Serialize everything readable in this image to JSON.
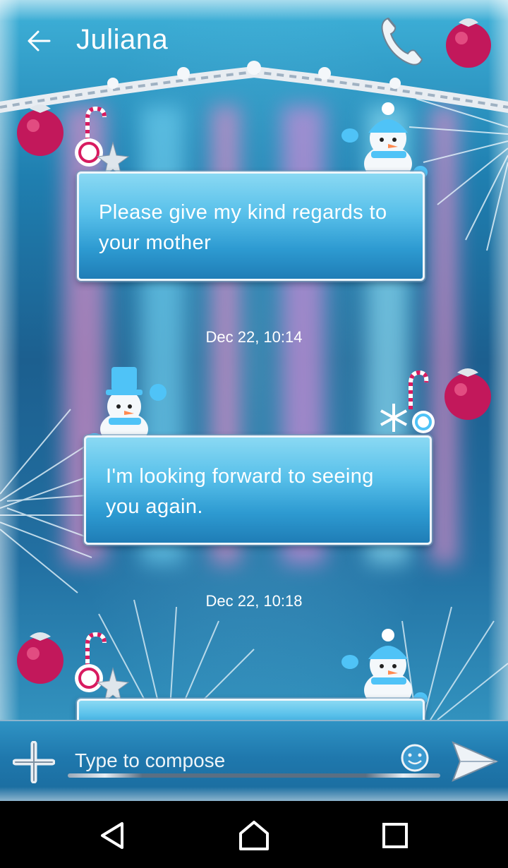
{
  "header": {
    "back_icon": "arrow-left-icon",
    "title": "Juliana",
    "call_icon": "phone-icon"
  },
  "messages": [
    {
      "text": "Please give my kind regards to your mother",
      "timestamp": "Dec 22, 10:14"
    },
    {
      "text": "I'm looking forward to seeing  you  again.",
      "timestamp": "Dec 22, 10:18"
    }
  ],
  "composer": {
    "add_icon": "plus-icon",
    "placeholder": "Type to compose",
    "emoji_icon": "smiley-icon",
    "send_icon": "send-icon"
  },
  "navbar": {
    "back_icon": "triangle-back-icon",
    "home_icon": "home-icon",
    "recents_icon": "square-recents-icon"
  },
  "colors": {
    "ornament": "#c2185b",
    "bubble_top": "#8ad9f3",
    "bubble_bottom": "#1f7db6",
    "background_dark": "#1c5f8f"
  }
}
